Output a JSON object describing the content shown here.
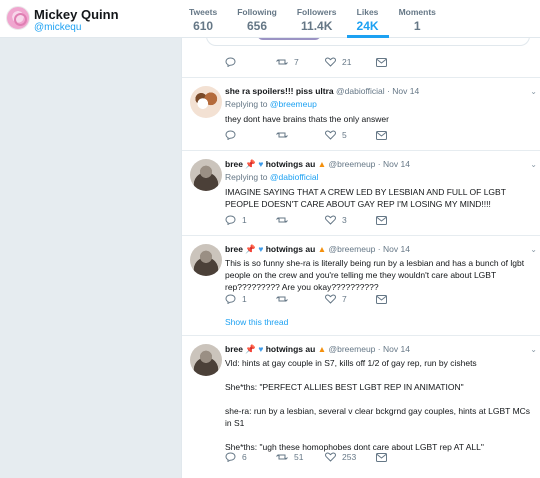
{
  "profile": {
    "name": "Mickey Quinn",
    "handle": "@mickequ"
  },
  "stats": [
    {
      "label": "Tweets",
      "value": "610",
      "active": false
    },
    {
      "label": "Following",
      "value": "656",
      "active": false
    },
    {
      "label": "Followers",
      "value": "11.4K",
      "active": false
    },
    {
      "label": "Likes",
      "value": "24K",
      "active": true
    },
    {
      "label": "Moments",
      "value": "1",
      "active": false
    }
  ],
  "top_actions": {
    "retweets": "7",
    "likes": "21"
  },
  "tweets": [
    {
      "name": "she ra spoilers!!! piss ultra",
      "handle": "@dabiofficial",
      "date": "Nov 14",
      "reply_label": "Replying to",
      "reply_to": "@breemeup",
      "text": [
        "they dont have brains thats the only answer"
      ],
      "replies": "",
      "retweets": "",
      "likes": "5"
    },
    {
      "name": "bree",
      "name_suffix": "hotwings au",
      "handle": "@breemeup",
      "date": "Nov 14",
      "reply_label": "Replying to",
      "reply_to": "@dabiofficial",
      "text": [
        "IMAGINE SAYING THAT A CREW LED BY LESBIAN AND FULL OF LGBT PEOPLE DOESN'T CARE ABOUT GAY REP I'M LOSING MY MIND!!!!"
      ],
      "replies": "1",
      "retweets": "",
      "likes": "3"
    },
    {
      "name": "bree",
      "name_suffix": "hotwings au",
      "handle": "@breemeup",
      "date": "Nov 14",
      "text": [
        "This is so funny she-ra is literally being run by a lesbian and has a bunch of lgbt people on the crew and you're telling me they wouldn't care about LGBT rep????????? Are you okay??????????"
      ],
      "replies": "1",
      "retweets": "",
      "likes": "7",
      "show_thread": "Show this thread"
    },
    {
      "name": "bree",
      "name_suffix": "hotwings au",
      "handle": "@breemeup",
      "date": "Nov 14",
      "text": [
        "Vld: hints at gay couple in S7, kills off 1/2 of gay rep, run by cishets",
        "She*ths: \"PERFECT ALLIES BEST LGBT REP IN ANIMATION\"",
        "she-ra: run by a lesbian, several v clear bckgrnd gay couples, hints at LGBT MCs in S1",
        "She*ths: \"ugh these homophobes dont care about LGBT rep AT ALL\""
      ],
      "replies": "6",
      "retweets": "51",
      "likes": "253"
    }
  ]
}
